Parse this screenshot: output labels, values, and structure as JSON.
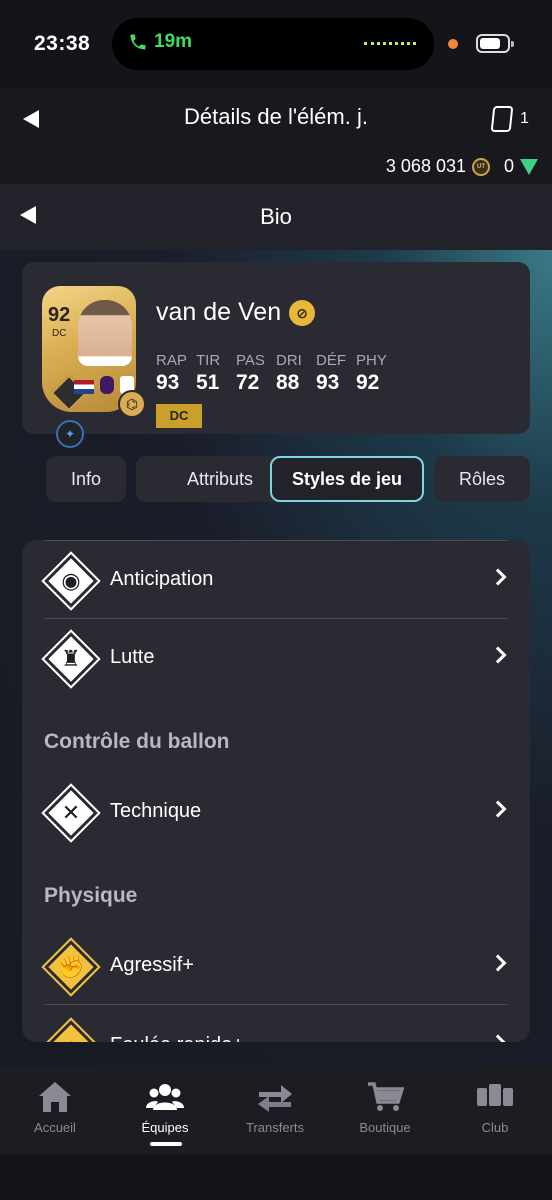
{
  "status_bar": {
    "time": "23:38",
    "call_duration": "19m",
    "call_color": "#3fdc5f"
  },
  "header": {
    "title": "Détails de l'élém. j.",
    "pack_count": "1",
    "coins": "3 068 031",
    "coin_label": "UT",
    "points": "0"
  },
  "subheader": {
    "title": "Bio"
  },
  "player": {
    "rating": "92",
    "position": "DC",
    "name": "van de Ven",
    "position_badge": "DC",
    "chemistry_icon": "dna-icon",
    "stats": [
      {
        "label": "RAP",
        "value": "93"
      },
      {
        "label": "TIR",
        "value": "51"
      },
      {
        "label": "PAS",
        "value": "72"
      },
      {
        "label": "DRI",
        "value": "88"
      },
      {
        "label": "DÉF",
        "value": "93"
      },
      {
        "label": "PHY",
        "value": "92"
      }
    ]
  },
  "tabs": [
    {
      "label": "Info",
      "active": false
    },
    {
      "label": "Attributs",
      "active": false
    },
    {
      "label": "Styles de jeu",
      "active": true
    },
    {
      "label": "Rôles",
      "active": false
    }
  ],
  "playstyles": {
    "items_defense": [
      {
        "label": "Anticipation",
        "icon": "raccoon-icon"
      },
      {
        "label": "Lutte",
        "icon": "wrestler-icon"
      }
    ],
    "section_ball_control": "Contrôle du ballon",
    "items_ball_control": [
      {
        "label": "Technique",
        "icon": "tactics-icon"
      }
    ],
    "section_physical": "Physique",
    "items_physical": [
      {
        "label": "Agressif+",
        "icon": "flexed-arm-icon"
      },
      {
        "label": "Foulée rapide+",
        "icon": "rocket-icon"
      }
    ]
  },
  "nav": [
    {
      "label": "Accueil",
      "icon": "home-icon",
      "active": false
    },
    {
      "label": "Équipes",
      "icon": "people-icon",
      "active": true
    },
    {
      "label": "Transferts",
      "icon": "transfer-arrows-icon",
      "active": false
    },
    {
      "label": "Boutique",
      "icon": "cart-icon",
      "active": false
    },
    {
      "label": "Club",
      "icon": "club-icon",
      "active": false
    }
  ],
  "colors": {
    "accent_tab_border": "#7cd7dc",
    "gold": "#f2c23e",
    "background": "#141419"
  }
}
